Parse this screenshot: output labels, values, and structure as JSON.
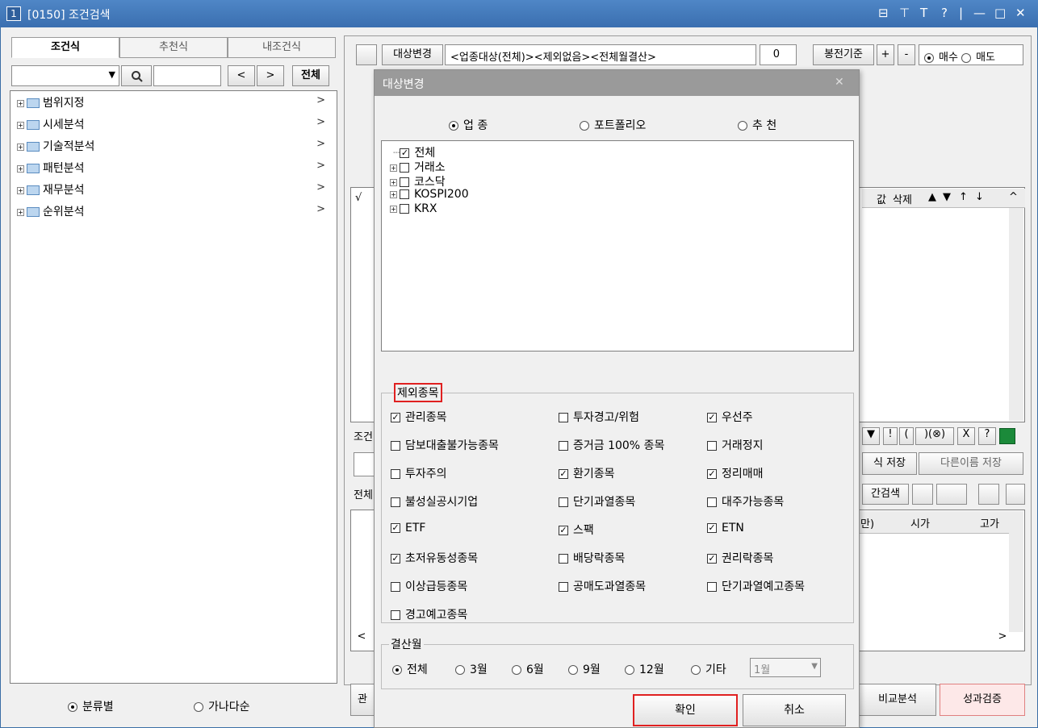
{
  "window": {
    "number": "1",
    "title": "[0150] 조건검색",
    "controls": [
      "⊟",
      "⊤",
      "T",
      "?",
      "|",
      "—",
      "□",
      "✕"
    ]
  },
  "left": {
    "tabs": [
      "조건식",
      "추천식",
      "내조건식"
    ],
    "all_button": "전체",
    "prev": "<",
    "next": ">",
    "tree": [
      "범위지정",
      "시세분석",
      "기술적분석",
      "패턴분석",
      "재무분석",
      "순위분석"
    ],
    "sort_options": [
      {
        "label": "분류별",
        "selected": true
      },
      {
        "label": "가나다순",
        "selected": false
      }
    ]
  },
  "right": {
    "target_button": "대상변경",
    "target_text": "<업종대상(전체)><제외없음><전체월결산>",
    "number": "0",
    "candle_basis": "봉전기준",
    "plus": "+",
    "minus": "-",
    "buy": "매수",
    "sell": "매도",
    "grid_header_right": [
      "값",
      "삭제",
      "▲",
      "▼",
      "↑",
      "↓",
      "^"
    ],
    "check_col": "√",
    "cond_label": "조건",
    "save": "식 저장",
    "save_as": "다른이름 저장",
    "result_label": "전체",
    "search_btn": "간검색",
    "result_cols": [
      "만)",
      "시가",
      "고가"
    ],
    "bottom_left": "관",
    "compare": "비교분석",
    "perf": "성과검증",
    "ops": [
      "▼",
      "!",
      "(",
      ")(⊗)",
      "X",
      "?"
    ]
  },
  "dialog": {
    "title": "대상변경",
    "close": "✕",
    "modes": [
      {
        "label": "업 종",
        "selected": true
      },
      {
        "label": "포트폴리오",
        "selected": false
      },
      {
        "label": "추 천",
        "selected": false
      }
    ],
    "markets": [
      {
        "label": "전체",
        "checked": true
      },
      {
        "label": "거래소",
        "checked": false
      },
      {
        "label": "코스닥",
        "checked": false
      },
      {
        "label": "KOSPI200",
        "checked": false
      },
      {
        "label": "KRX",
        "checked": false
      }
    ],
    "exclude_label": "제외종목",
    "exclude": [
      {
        "label": "관리종목",
        "checked": true
      },
      {
        "label": "투자경고/위험",
        "checked": false
      },
      {
        "label": "우선주",
        "checked": true
      },
      {
        "label": "담보대출불가능종목",
        "checked": false
      },
      {
        "label": "증거금 100% 종목",
        "checked": false
      },
      {
        "label": "거래정지",
        "checked": false
      },
      {
        "label": "투자주의",
        "checked": false
      },
      {
        "label": "환기종목",
        "checked": true
      },
      {
        "label": "정리매매",
        "checked": true
      },
      {
        "label": "불성실공시기업",
        "checked": false
      },
      {
        "label": "단기과열종목",
        "checked": false
      },
      {
        "label": "대주가능종목",
        "checked": false
      },
      {
        "label": "ETF",
        "checked": true
      },
      {
        "label": "스팩",
        "checked": true
      },
      {
        "label": "ETN",
        "checked": true
      },
      {
        "label": "초저유동성종목",
        "checked": true
      },
      {
        "label": "배당락종목",
        "checked": false
      },
      {
        "label": "권리락종목",
        "checked": true
      },
      {
        "label": "이상급등종목",
        "checked": false
      },
      {
        "label": "공매도과열종목",
        "checked": false
      },
      {
        "label": "단기과열예고종목",
        "checked": false
      },
      {
        "label": "경고예고종목",
        "checked": false
      }
    ],
    "settle_label": "결산월",
    "settle": [
      {
        "label": "전체",
        "selected": true
      },
      {
        "label": "3월",
        "selected": false
      },
      {
        "label": "6월",
        "selected": false
      },
      {
        "label": "9월",
        "selected": false
      },
      {
        "label": "12월",
        "selected": false
      },
      {
        "label": "기타",
        "selected": false
      }
    ],
    "month_value": "1월",
    "ok": "확인",
    "cancel": "취소"
  },
  "colors": {
    "title_bar": "#3a6fb0",
    "highlight": "#e02020",
    "dialog_title": "#9a9a9a"
  }
}
